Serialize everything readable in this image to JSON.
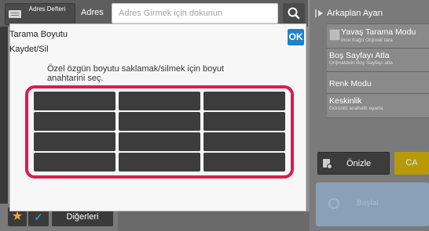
{
  "header": {
    "address_book_label": "Adres Defteri",
    "address_label": "Adres",
    "address_placeholder": "Adres Girmek için dokunun"
  },
  "dialog": {
    "title_line1": "Tarama Boyutu",
    "title_line2": "Kaydet/Sil",
    "ok_label": "OK",
    "description": "Özel özgün boyutu saklamak/silmek için boyut anahtarini seç.",
    "size_keys": [
      "",
      "",
      "",
      "",
      "",
      "",
      "",
      "",
      "",
      "",
      "",
      ""
    ]
  },
  "right_panel": {
    "header": "Arkaplan Ayarı",
    "items": [
      {
        "title": "Yavaş Tarama Modu",
        "subtitle": "İnce Kağıt Orijinali tara"
      },
      {
        "title": "Boş Sayfayı Atla",
        "subtitle": "Orijinaldeki Boş Sayfayı atla"
      },
      {
        "title": "Renk Modu",
        "subtitle": ""
      },
      {
        "title": "Keskinlik",
        "subtitle": "Görüntü anahattı ayarla"
      }
    ],
    "preview_label": "Önizle",
    "ca_label": "CA",
    "start_label": "Başlat"
  },
  "bottom_bar": {
    "other_label": "Diğerleri"
  },
  "colors": {
    "accent_red": "#d81e4d",
    "ok_blue": "#1b83d2",
    "ca_yellow": "#b89a08"
  }
}
